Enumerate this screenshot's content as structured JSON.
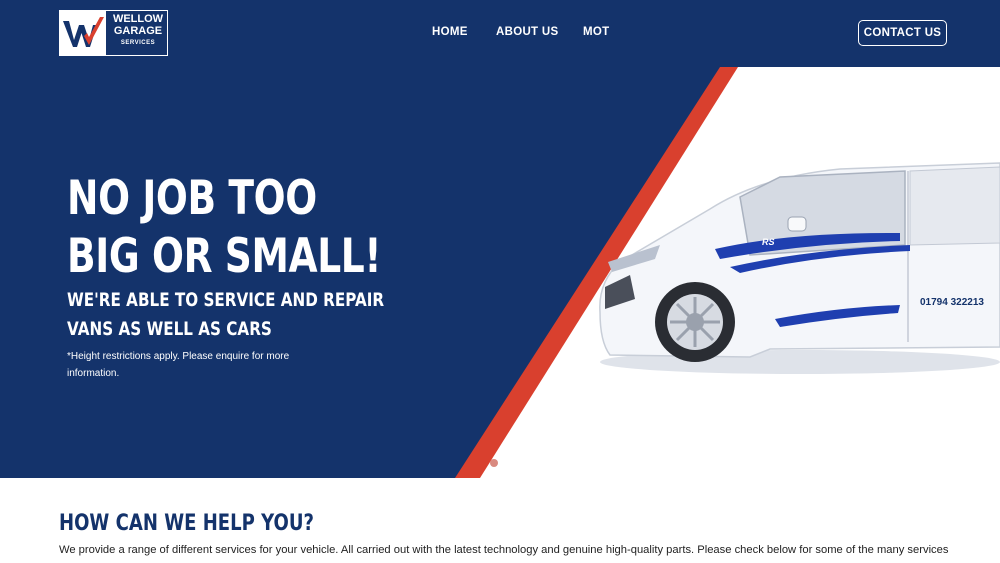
{
  "colors": {
    "navy": "#14336b",
    "red_stripe": "#d9402e",
    "white": "#ffffff"
  },
  "logo": {
    "line1": "WELLOW",
    "line2": "GARAGE",
    "line3": "SERVICES"
  },
  "nav": {
    "items": [
      {
        "label": "HOME"
      },
      {
        "label": "ABOUT US"
      },
      {
        "label": "MOT"
      }
    ],
    "contact_label": "CONTACT US"
  },
  "hero": {
    "headline_line1": "NO JOB TOO",
    "headline_line2": "BIG OR SMALL!",
    "subhead_line1": "WE'RE ABLE TO SERVICE AND REPAIR",
    "subhead_line2": "VANS AS WELL AS CARS",
    "note": "*Height restrictions apply. Please enquire for more information.",
    "van_phone": "01794 322213",
    "van_badge": "RS",
    "slider_dots": [
      {
        "active": false
      },
      {
        "active": true
      }
    ]
  },
  "help": {
    "title": "HOW CAN WE HELP YOU?",
    "text": "We provide a range of different services for your vehicle. All carried out with the latest technology and genuine high-quality parts. Please check below for some of the many services"
  }
}
